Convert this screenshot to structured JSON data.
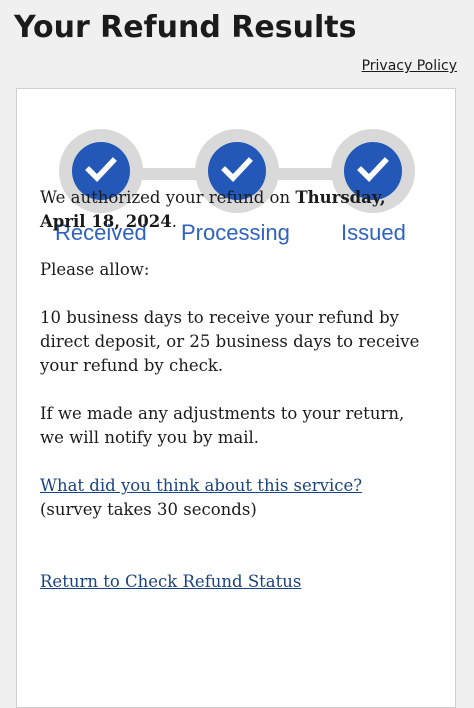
{
  "header": {
    "title": "Your Refund Results",
    "privacy_link": "Privacy Policy"
  },
  "tracker": {
    "steps": [
      {
        "label": "Received",
        "status": "complete",
        "icon": "checkmark-icon"
      },
      {
        "label": "Processing",
        "status": "complete",
        "icon": "checkmark-icon"
      },
      {
        "label": "Issued",
        "status": "complete",
        "icon": "checkmark-icon"
      }
    ],
    "colors": {
      "complete_fill": "#2357b8",
      "ring": "#d9d9d9",
      "label": "#2f63bf"
    }
  },
  "message": {
    "authorized_prefix": "We authorized your refund on ",
    "authorized_date": "Thursday, April 18, 2024",
    "authorized_suffix": ".",
    "please_allow": "Please allow:",
    "timing": "10 business days to receive your refund by direct deposit, or 25 business days to receive your refund by check.",
    "adjustments": "If we made any adjustments to your return, we will notify you by mail.",
    "survey_link": "What did you think about this service?",
    "survey_note": "(survey takes 30 seconds)",
    "return_link": "Return to Check Refund Status"
  }
}
